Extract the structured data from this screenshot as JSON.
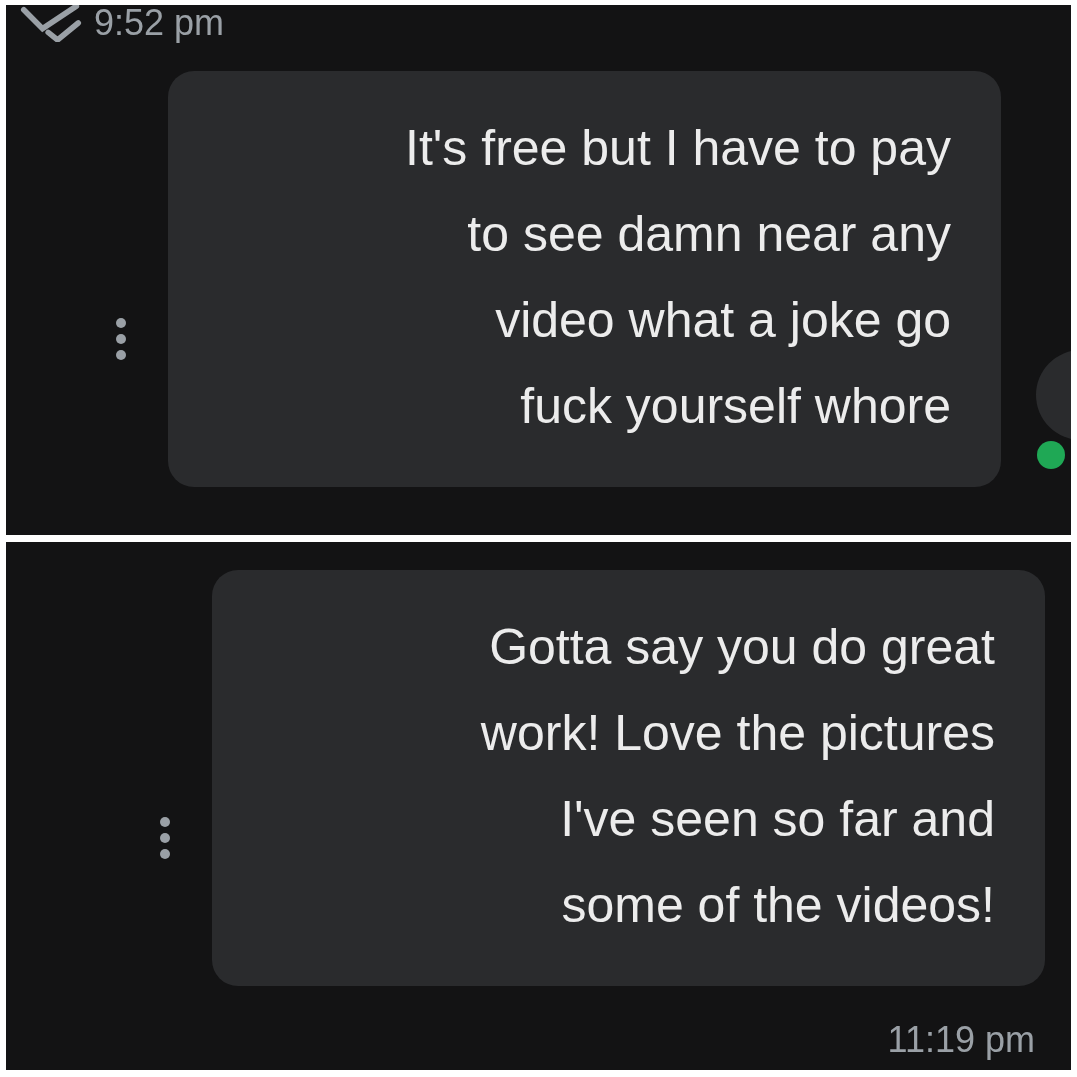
{
  "panels": [
    {
      "time": "9:52 pm",
      "read": true,
      "message": "It's free but I have to pay\nto see damn near any\nvideo what a joke go\nfuck yourself whore",
      "online": true
    },
    {
      "time": "11:19 pm",
      "read": false,
      "message": "Gotta say you do great\nwork! Love the pictures\nI've seen so far and\nsome of the videos!",
      "online": false
    }
  ]
}
